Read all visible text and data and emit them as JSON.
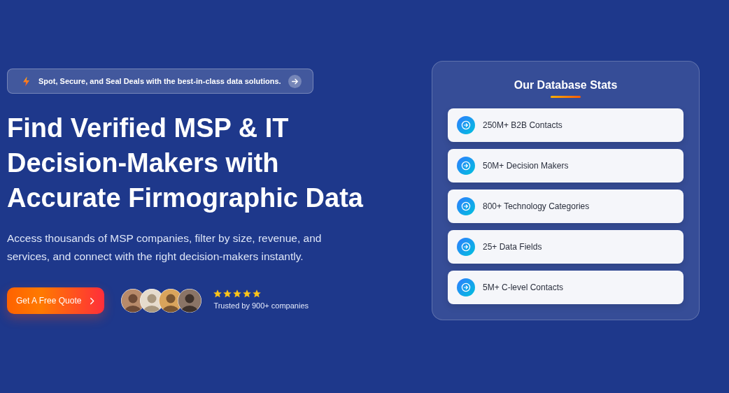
{
  "announcement": {
    "text": "Spot, Secure, and Seal Deals with the best-in-class data solutions."
  },
  "hero": {
    "heading": "Find Verified MSP & IT Decision-Makers with Accurate Firmographic Data",
    "description": "Access thousands of MSP companies, filter by size, revenue, and services, and connect with the right decision-makers instantly.",
    "cta": "Get A Free Quote"
  },
  "social_proof": {
    "stars": 5,
    "caption": "Trusted by 900+ companies"
  },
  "stats_card": {
    "title": "Our Database Stats",
    "items": [
      {
        "label": "250M+ B2B Contacts"
      },
      {
        "label": "50M+ Decision Makers"
      },
      {
        "label": "800+ Technology Categories"
      },
      {
        "label": "25+ Data Fields"
      },
      {
        "label": "5M+ C-level Contacts"
      }
    ]
  }
}
